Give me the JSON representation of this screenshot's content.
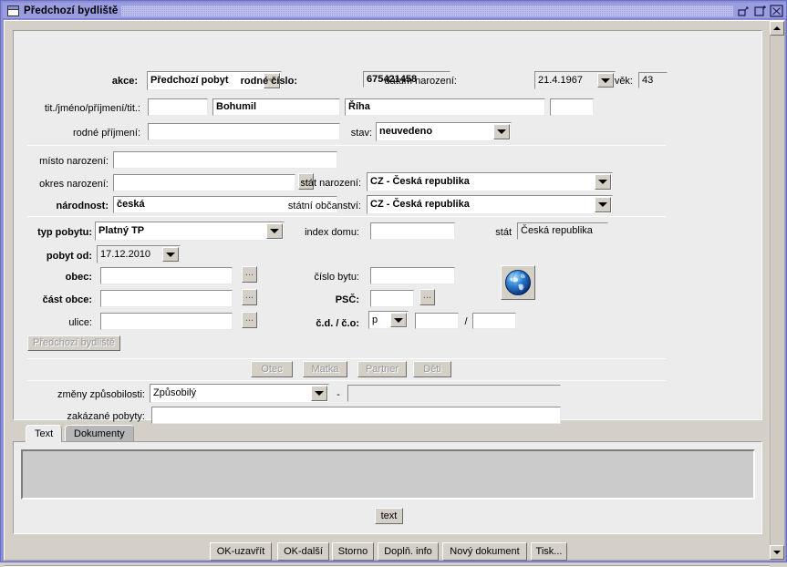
{
  "window": {
    "title": "Předchozí bydliště",
    "icon": "window-icon",
    "controls": [
      {
        "name": "minimize-button",
        "icon": "minimize-icon"
      },
      {
        "name": "maximize-button",
        "icon": "maximize-icon"
      },
      {
        "name": "close-button",
        "icon": "close-icon"
      }
    ]
  },
  "form": {
    "akce": {
      "label": "akce:",
      "value": "Předchozí pobyt"
    },
    "rodne_cislo": {
      "label": "rodné číslo:",
      "value": "675421458"
    },
    "datum_narozeni": {
      "label": "datum narození:",
      "value": "21.4.1967"
    },
    "vek": {
      "label": "věk:",
      "value": "43"
    },
    "jmeno_row": {
      "label": "tit./jméno/příjmení/tit.:",
      "titul_pred": "",
      "jmeno": "Bohumil",
      "prijmeni": "Říha",
      "titul_za": ""
    },
    "rodne_prijmeni": {
      "label": "rodné příjmení:",
      "value": ""
    },
    "stav": {
      "label": "stav:",
      "value": "neuvedeno"
    },
    "misto_narozeni": {
      "label": "místo narození:",
      "value": ""
    },
    "okres_narozeni": {
      "label": "okres narození:",
      "value": "",
      "browse": "..."
    },
    "narodnost": {
      "label": "národnost:",
      "value": "česká"
    },
    "stat_narozeni": {
      "label": "stát narození:",
      "value": "CZ - Česká republika"
    },
    "statni_obcanstvi": {
      "label": "státní občanství:",
      "value": "CZ - Česká republika"
    },
    "typ_pobytu": {
      "label": "typ pobytu:",
      "value": "Platný TP"
    },
    "pobyt_od": {
      "label": "pobyt od:",
      "value": "17.12.2010"
    },
    "obec": {
      "label": "obec:",
      "value": "",
      "browse": "..."
    },
    "cast_obce": {
      "label": "část obce:",
      "value": "",
      "browse": "..."
    },
    "ulice": {
      "label": "ulice:",
      "value": "",
      "browse": "..."
    },
    "index_domu": {
      "label": "index domu:",
      "value": ""
    },
    "stat": {
      "label": "stát",
      "value": "Česká republika"
    },
    "cislo_bytu": {
      "label": "číslo bytu:",
      "value": ""
    },
    "psc": {
      "label": "PSČ:",
      "value": "",
      "browse": "..."
    },
    "cd_co": {
      "label": "č.d. / č.o:",
      "type_value": "p",
      "cislo_domu": "",
      "separator": "/",
      "cislo_orientacni": ""
    },
    "globe_button": {
      "icon": "globe-icon"
    },
    "predchozi_bydliste_button": {
      "label": "Předchozí bydliště",
      "disabled": true
    },
    "relation_buttons": [
      {
        "label": "Otec",
        "disabled": true
      },
      {
        "label": "Matka",
        "disabled": true
      },
      {
        "label": "Partner",
        "disabled": true
      },
      {
        "label": "Děti",
        "disabled": true
      }
    ],
    "zmeny_zpusobilosti": {
      "label": "změny způsobilosti:",
      "value": "Způsobilý",
      "dash": "-",
      "detail": ""
    },
    "zakazane_pobyty": {
      "label": "zakázané pobyty:",
      "value": ""
    }
  },
  "tabs": [
    {
      "label": "Text",
      "active": true
    },
    {
      "label": "Dokumenty",
      "active": false
    }
  ],
  "tab_content": {
    "textarea_value": "",
    "text_button": "text"
  },
  "bottom_buttons": [
    {
      "label": "OK-uzavřít"
    },
    {
      "label": "OK-další"
    },
    {
      "label": "Storno"
    },
    {
      "label": "Doplň. info"
    },
    {
      "label": "Nový dokument"
    },
    {
      "label": "Tisk..."
    }
  ],
  "scrollbar": {
    "up_icon": "scroll-up-arrow",
    "down_icon": "scroll-down-arrow"
  },
  "colors": {
    "titlebar": "#9a9ee0",
    "frame": "#8b8fd6",
    "panel": "#ececec",
    "control": "#d4d0c8"
  }
}
